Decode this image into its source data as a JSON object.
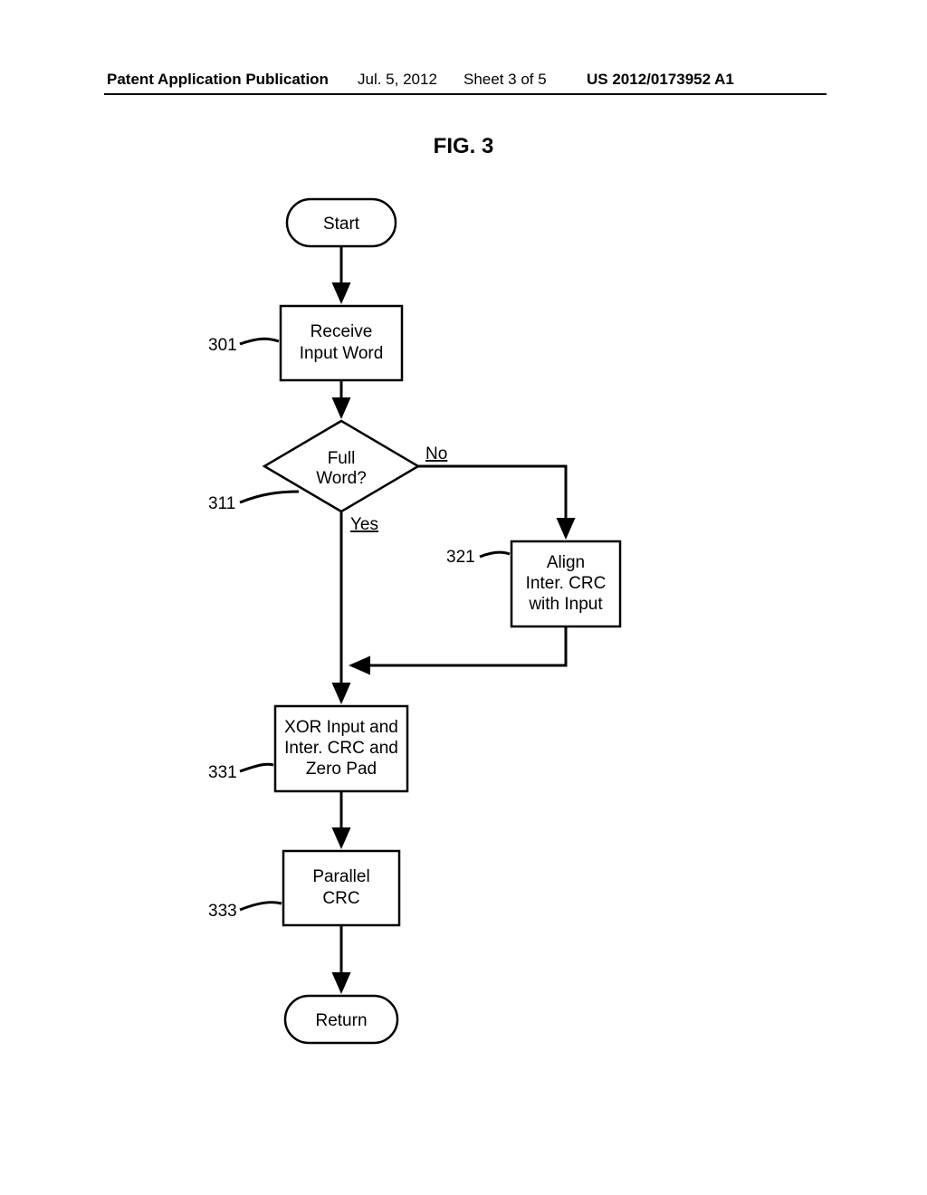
{
  "header": {
    "left": "Patent Application Publication",
    "date": "Jul. 5, 2012",
    "sheet": "Sheet 3 of 5",
    "pubnum": "US 2012/0173952 A1"
  },
  "figure_title": "FIG. 3",
  "nodes": {
    "start": "Start",
    "receive_l1": "Receive",
    "receive_l2": "Input Word",
    "full_l1": "Full",
    "full_l2": "Word?",
    "align_l1": "Align",
    "align_l2": "Inter. CRC",
    "align_l3": "with Input",
    "xor_l1": "XOR Input and",
    "xor_l2": "Inter. CRC and",
    "xor_l3": "Zero Pad",
    "parallel_l1": "Parallel",
    "parallel_l2": "CRC",
    "return": "Return"
  },
  "refs": {
    "receive": "301",
    "full": "311",
    "align": "321",
    "xor": "331",
    "parallel": "333"
  },
  "edges": {
    "no": "No",
    "yes": "Yes"
  }
}
